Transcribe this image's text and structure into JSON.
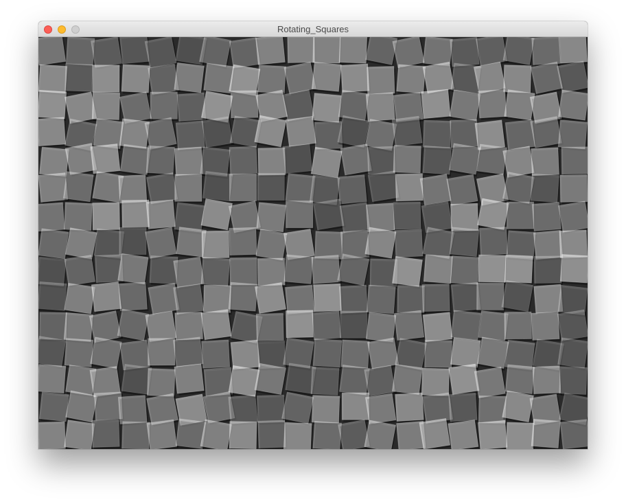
{
  "window": {
    "title": "Rotating_Squares",
    "controls": {
      "close": "close-button",
      "minimize": "minimize-button",
      "zoom": "zoom-button"
    }
  },
  "sketch": {
    "background_color": "#2a2a2a",
    "square_color": "#ffffff",
    "grid_columns": 20,
    "grid_rows": 15,
    "square_opacity": 0.42,
    "max_rotation_deg": 12
  }
}
